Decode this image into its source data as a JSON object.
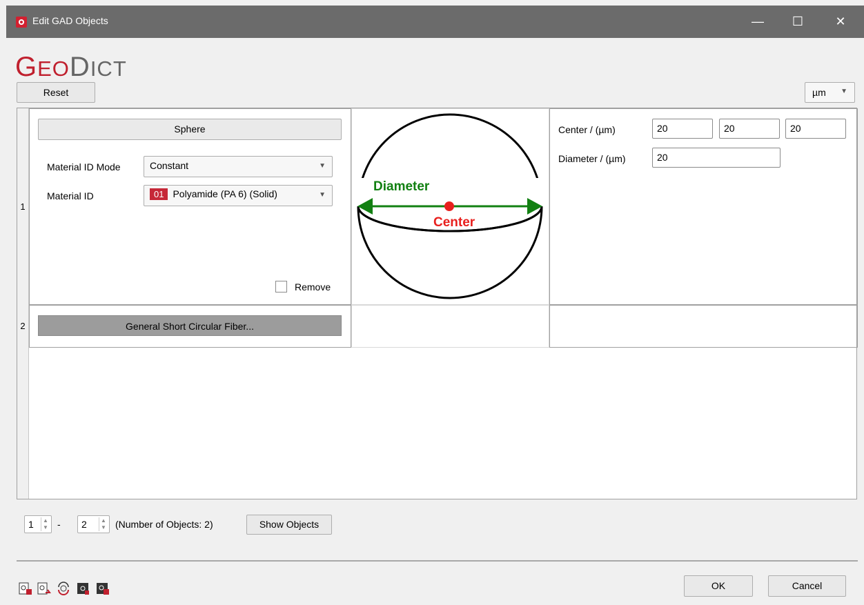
{
  "window": {
    "title": "Edit GAD Objects"
  },
  "titlebar_buttons": {
    "minimize": "—",
    "maximize": "☐",
    "close": "✕"
  },
  "logo": {
    "geo_g": "G",
    "geo_rest": "EO",
    "dict_d": "D",
    "dict_rest": "ICT"
  },
  "toolbar": {
    "reset_label": "Reset",
    "unit_value": "µm"
  },
  "rows": [
    {
      "number": "1",
      "object_type": "Sphere",
      "material_id_mode_label": "Material ID Mode",
      "material_id_mode_value": "Constant",
      "material_id_label": "Material ID",
      "material_id_badge": "01",
      "material_id_value": "Polyamide (PA 6) (Solid)",
      "remove_label": "Remove",
      "diagram": {
        "diameter_label": "Diameter",
        "center_label": "Center"
      },
      "params": {
        "center_label": "Center / (µm)",
        "center_x": "20",
        "center_y": "20",
        "center_z": "20",
        "diameter_label": "Diameter / (µm)",
        "diameter": "20"
      }
    },
    {
      "number": "2",
      "object_type": "General Short Circular Fiber..."
    }
  ],
  "range": {
    "from": "1",
    "dash": "-",
    "to": "2",
    "count_text": "(Number of Objects: 2)",
    "show_objects_label": "Show Objects"
  },
  "footer": {
    "ok_label": "OK",
    "cancel_label": "Cancel"
  },
  "icons": [
    "object-lock-icon",
    "object-export-icon",
    "object-refresh-icon",
    "object-dark-icon",
    "object-dark-lock-icon"
  ],
  "colors": {
    "accent": "#c0202e",
    "titlebar": "#6b6b6b",
    "diameter_green": "#128012",
    "center_red": "#e8201e"
  }
}
